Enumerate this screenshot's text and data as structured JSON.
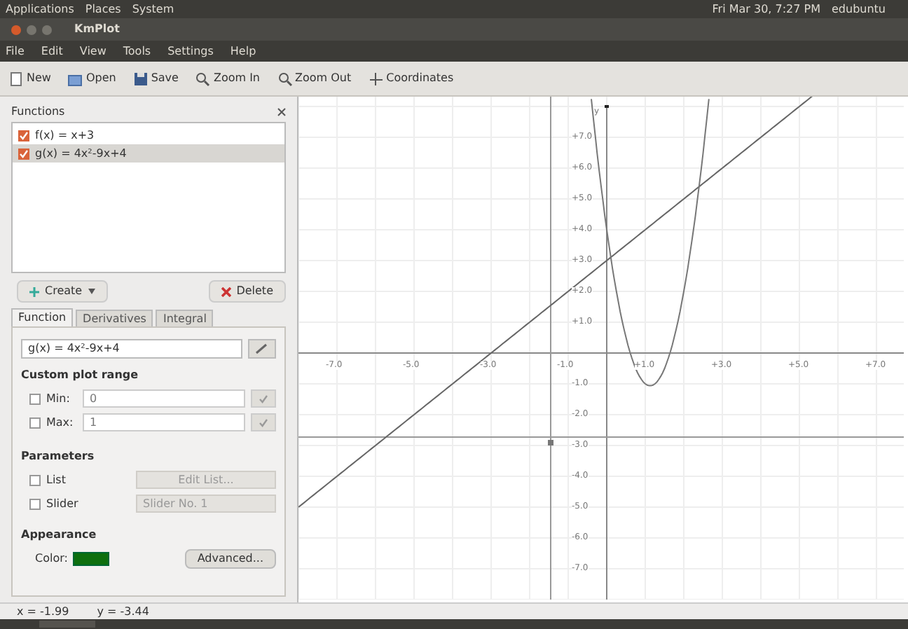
{
  "top_panel": {
    "menus": [
      "Applications",
      "Places",
      "System"
    ],
    "clock": "Fri Mar 30, 7:27 PM",
    "user": "edubuntu"
  },
  "window": {
    "title": "KmPlot"
  },
  "menu_bar": [
    "File",
    "Edit",
    "View",
    "Tools",
    "Settings",
    "Help"
  ],
  "toolbar": [
    {
      "kind": "new",
      "label": "New"
    },
    {
      "kind": "open",
      "label": "Open"
    },
    {
      "kind": "save",
      "label": "Save"
    },
    {
      "kind": "zoomin",
      "label": "Zoom In"
    },
    {
      "kind": "zoomout",
      "label": "Zoom Out"
    },
    {
      "kind": "coords",
      "label": "Coordinates"
    }
  ],
  "functions_panel": {
    "title": "Functions",
    "items": [
      {
        "label": "f(x) = x+3",
        "checked": true,
        "selected": false
      },
      {
        "label": "g(x) = 4x²-9x+4",
        "checked": true,
        "selected": true
      }
    ],
    "create": "Create",
    "delete": "Delete",
    "tabs": [
      {
        "label": "Function",
        "selected": true
      },
      {
        "label": "Derivatives",
        "selected": false
      },
      {
        "label": "Integral",
        "selected": false
      }
    ],
    "equation": "g(x) = 4x²-9x+4",
    "custom_range": {
      "title": "Custom plot range",
      "rows": [
        {
          "label": "Min:",
          "value": "0",
          "checked": false
        },
        {
          "label": "Max:",
          "value": "1",
          "checked": false
        }
      ]
    },
    "parameters": {
      "title": "Parameters",
      "rows": [
        {
          "kind": "button",
          "label": "List",
          "control": "Edit List...",
          "checked": false
        },
        {
          "kind": "dropdown",
          "label": "Slider",
          "control": "Slider No. 1",
          "checked": false
        }
      ]
    },
    "appearance": {
      "title": "Appearance",
      "color_label": "Color:",
      "advanced": "Advanced..."
    }
  },
  "plot": {
    "x_tick_labels": [
      "-7.0",
      "-5.0",
      "-3.0",
      "-1.0",
      "+1.0",
      "+3.0",
      "+5.0",
      "+7.0"
    ],
    "y_tick_labels_above": [
      "+7.0",
      "+6.0",
      "+5.0",
      "+4.0",
      "+3.0",
      "+2.0",
      "+1.0"
    ],
    "y_tick_labels_below": [
      "-1.0",
      "-2.0",
      "-3.0",
      "-4.0",
      "-5.0",
      "-6.0",
      "-7.0"
    ],
    "y_axis_label": "y"
  },
  "status_bar": [
    "x = -1.99",
    "y = -3.44"
  ]
}
